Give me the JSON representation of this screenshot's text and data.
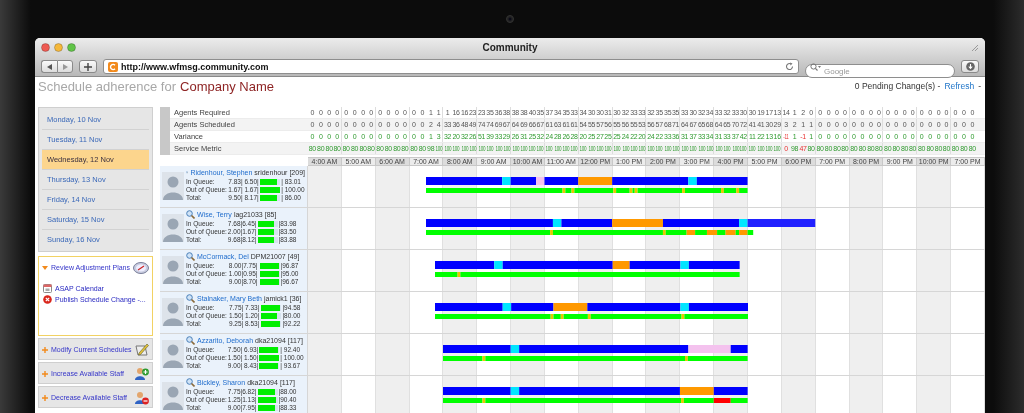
{
  "browser": {
    "title": "Community",
    "url": "http://www.wfmsg.community.com",
    "search": {
      "placeholder": "Google"
    }
  },
  "header": {
    "title": "Schedule adherence for",
    "company": "Company Name",
    "pending": "0 Pending Change(s) -",
    "refresh": "Refresh",
    "trailer": "-"
  },
  "days": [
    {
      "label": "Monday, 10 Nov",
      "selected": false
    },
    {
      "label": "Tuesday, 11 Nov",
      "selected": false
    },
    {
      "label": "Wednesday, 12 Nov",
      "selected": true
    },
    {
      "label": "Thursday, 13 Nov",
      "selected": false
    },
    {
      "label": "Friday, 14 Nov",
      "selected": false
    },
    {
      "label": "Saturday, 15 Nov",
      "selected": false
    },
    {
      "label": "Sunday, 16 Nov",
      "selected": false
    }
  ],
  "panels": [
    {
      "title": "Review Adjustment Plans",
      "expanded": true,
      "items": [
        "ASAP Calendar",
        "Publish Schedule Change -..."
      ]
    },
    {
      "title": "Modify Current Schedules",
      "expanded": false
    },
    {
      "title": "Increase Available Staff",
      "expanded": false
    },
    {
      "title": "Decrease Available Staff",
      "expanded": false
    }
  ],
  "metrics": [
    {
      "label": "Agents Required",
      "kind": "count",
      "values": [
        "0",
        "0",
        "0",
        "0",
        "0",
        "0",
        "0",
        "0",
        "0",
        "0",
        "0",
        "0",
        "0",
        "0",
        "1",
        "1",
        "1",
        "16",
        "16",
        "23",
        "23",
        "35",
        "36",
        "38",
        "38",
        "38",
        "40",
        "35",
        "37",
        "34",
        "35",
        "33",
        "34",
        "30",
        "30",
        "31",
        "30",
        "32",
        "33",
        "33",
        "32",
        "35",
        "35",
        "35",
        "33",
        "30",
        "32",
        "34",
        "33",
        "32",
        "33",
        "30",
        "30",
        "19",
        "17",
        "13",
        "14",
        "1",
        "2",
        "0",
        "0",
        "0",
        "0",
        "0",
        "0",
        "0",
        "0",
        "0",
        "0",
        "0",
        "0",
        "0",
        "0",
        "0",
        "0",
        "0",
        "0",
        "0",
        "0"
      ]
    },
    {
      "label": "Agents Scheduled",
      "kind": "count",
      "values": [
        "0",
        "0",
        "0",
        "0",
        "0",
        "0",
        "0",
        "0",
        "0",
        "0",
        "0",
        "0",
        "0",
        "0",
        "2",
        "4",
        "33",
        "36",
        "48",
        "49",
        "74",
        "74",
        "69",
        "67",
        "64",
        "69",
        "66",
        "67",
        "61",
        "63",
        "61",
        "61",
        "54",
        "55",
        "57",
        "56",
        "55",
        "56",
        "55",
        "53",
        "56",
        "57",
        "68",
        "71",
        "64",
        "67",
        "65",
        "68",
        "64",
        "65",
        "70",
        "72",
        "41",
        "41",
        "30",
        "29",
        "3",
        "2",
        "1",
        "1",
        "0",
        "0",
        "0",
        "0",
        "0",
        "0",
        "0",
        "0",
        "0",
        "0",
        "0",
        "0",
        "0",
        "0",
        "0",
        "0",
        "0",
        "0",
        "0"
      ]
    },
    {
      "label": "Variance",
      "kind": "variance",
      "values": [
        "0",
        "0",
        "0",
        "0",
        "0",
        "0",
        "0",
        "0",
        "0",
        "0",
        "0",
        "0",
        "0",
        "0",
        "1",
        "3",
        "32",
        "20",
        "32",
        "26",
        "51",
        "39",
        "33",
        "29",
        "26",
        "31",
        "25",
        "32",
        "24",
        "28",
        "26",
        "28",
        "20",
        "25",
        "27",
        "25",
        "25",
        "24",
        "22",
        "20",
        "24",
        "22",
        "33",
        "36",
        "31",
        "37",
        "33",
        "34",
        "31",
        "33",
        "37",
        "42",
        "11",
        "22",
        "13",
        "16",
        "-11",
        "1",
        "-1",
        "1",
        "0",
        "0",
        "0",
        "0",
        "0",
        "0",
        "0",
        "0",
        "0",
        "0",
        "0",
        "0",
        "0",
        "0",
        "0",
        "0",
        "0",
        "0",
        "0"
      ]
    },
    {
      "label": "Service Metric",
      "kind": "service",
      "values": [
        "80",
        "80",
        "80",
        "80",
        "80",
        "80",
        "80",
        "80",
        "80",
        "80",
        "80",
        "80",
        "80",
        "80",
        "98",
        "100",
        "100",
        "100",
        "100",
        "100",
        "100",
        "100",
        "100",
        "100",
        "100",
        "100",
        "100",
        "100",
        "100",
        "100",
        "100",
        "100",
        "100",
        "100",
        "100",
        "100",
        "100",
        "100",
        "100",
        "100",
        "100",
        "100",
        "100",
        "100",
        "100",
        "100",
        "100",
        "100",
        "100",
        "100",
        "100",
        "100",
        "100",
        "100",
        "100",
        "100",
        "0",
        "98",
        "47",
        "80",
        "80",
        "80",
        "80",
        "80",
        "80",
        "80",
        "80",
        "80",
        "80",
        "80",
        "80",
        "80",
        "80",
        "80",
        "80",
        "80",
        "80",
        "80",
        "80"
      ]
    }
  ],
  "hours": [
    "4:00 AM",
    "5:00 AM",
    "6:00 AM",
    "7:00 AM",
    "8:00 AM",
    "9:00 AM",
    "10:00 AM",
    "11:00 AM",
    "12:00 PM",
    "1:00 PM",
    "2:00 PM",
    "3:00 PM",
    "4:00 PM",
    "5:00 PM",
    "6:00 PM",
    "7:00 PM",
    "8:00 PM",
    "9:00 PM",
    "10:00 PM",
    "7:00 PM"
  ],
  "agents": [
    {
      "name": "Ridenhour, Stephen",
      "login": "sridenhour",
      "count": "[209]",
      "stats": [
        {
          "label": "In Queue:",
          "hours": "7.83| 6.50|",
          "level": 0.83,
          "percent": "| 83.01"
        },
        {
          "label": "Out of Queue:",
          "hours": "1.67| 1.67|",
          "level": 1,
          "percent": "| 100.00"
        },
        {
          "label": "Total:",
          "hours": "9.50| 8.17|",
          "level": 0.86,
          "percent": "| 86.00"
        }
      ]
    },
    {
      "name": "Wise, Terry",
      "login": "lag21033",
      "count": "[85]",
      "stats": [
        {
          "label": "In Queue:",
          "hours": "7.68|6.45|",
          "level": 0.84,
          "percent": "|83.98"
        },
        {
          "label": "Out of Queue:",
          "hours": "2.00|1.67|",
          "level": 0.84,
          "percent": "|83.50"
        },
        {
          "label": "Total:",
          "hours": "9.68|8.12|",
          "level": 0.84,
          "percent": "|83.88"
        }
      ]
    },
    {
      "name": "McCormack, Del",
      "login": "DPM21007",
      "count": "[49]",
      "stats": [
        {
          "label": "In Queue:",
          "hours": "8.00|7.75|",
          "level": 0.97,
          "percent": "|96.87"
        },
        {
          "label": "Out of Queue:",
          "hours": "1.00|0.95|",
          "level": 0.95,
          "percent": "|95.00"
        },
        {
          "label": "Total:",
          "hours": "9.00|8.70|",
          "level": 0.97,
          "percent": "|96.67"
        }
      ]
    },
    {
      "name": "Stalnaker, Mary Beth",
      "login": "jamick1",
      "count": "[36]",
      "stats": [
        {
          "label": "In Queue:",
          "hours": "7.75| 7.33|",
          "level": 0.95,
          "percent": "|94.58"
        },
        {
          "label": "Out of Queue:",
          "hours": "1.50| 1.20|",
          "level": 0.8,
          "percent": "|80.00"
        },
        {
          "label": "Total:",
          "hours": "9.25| 8.53|",
          "level": 0.92,
          "percent": "|92.22"
        }
      ]
    },
    {
      "name": "Azzarito, Deborah",
      "login": "dka21094",
      "count": "[117]",
      "stats": [
        {
          "label": "In Queue:",
          "hours": "7.50| 6.93|",
          "level": 0.92,
          "percent": "| 92.40"
        },
        {
          "label": "Out of Queue:",
          "hours": "1.50| 1.50|",
          "level": 1,
          "percent": "| 100.00"
        },
        {
          "label": "Total:",
          "hours": "9.00| 8.43|",
          "level": 0.94,
          "percent": "| 93.67"
        }
      ]
    },
    {
      "name": "Bickley, Sharon",
      "login": "dka21094",
      "count": "[117]",
      "stats": [
        {
          "label": "In Queue:",
          "hours": "7.75|6.82|",
          "level": 0.88,
          "percent": "|88.00"
        },
        {
          "label": "Out of Queue:",
          "hours": "1.25|1.13|",
          "level": 0.9,
          "percent": "|90.40"
        },
        {
          "label": "Total:",
          "hours": "9.00|7.95|",
          "level": 0.88,
          "percent": "|88.33"
        }
      ]
    }
  ]
}
